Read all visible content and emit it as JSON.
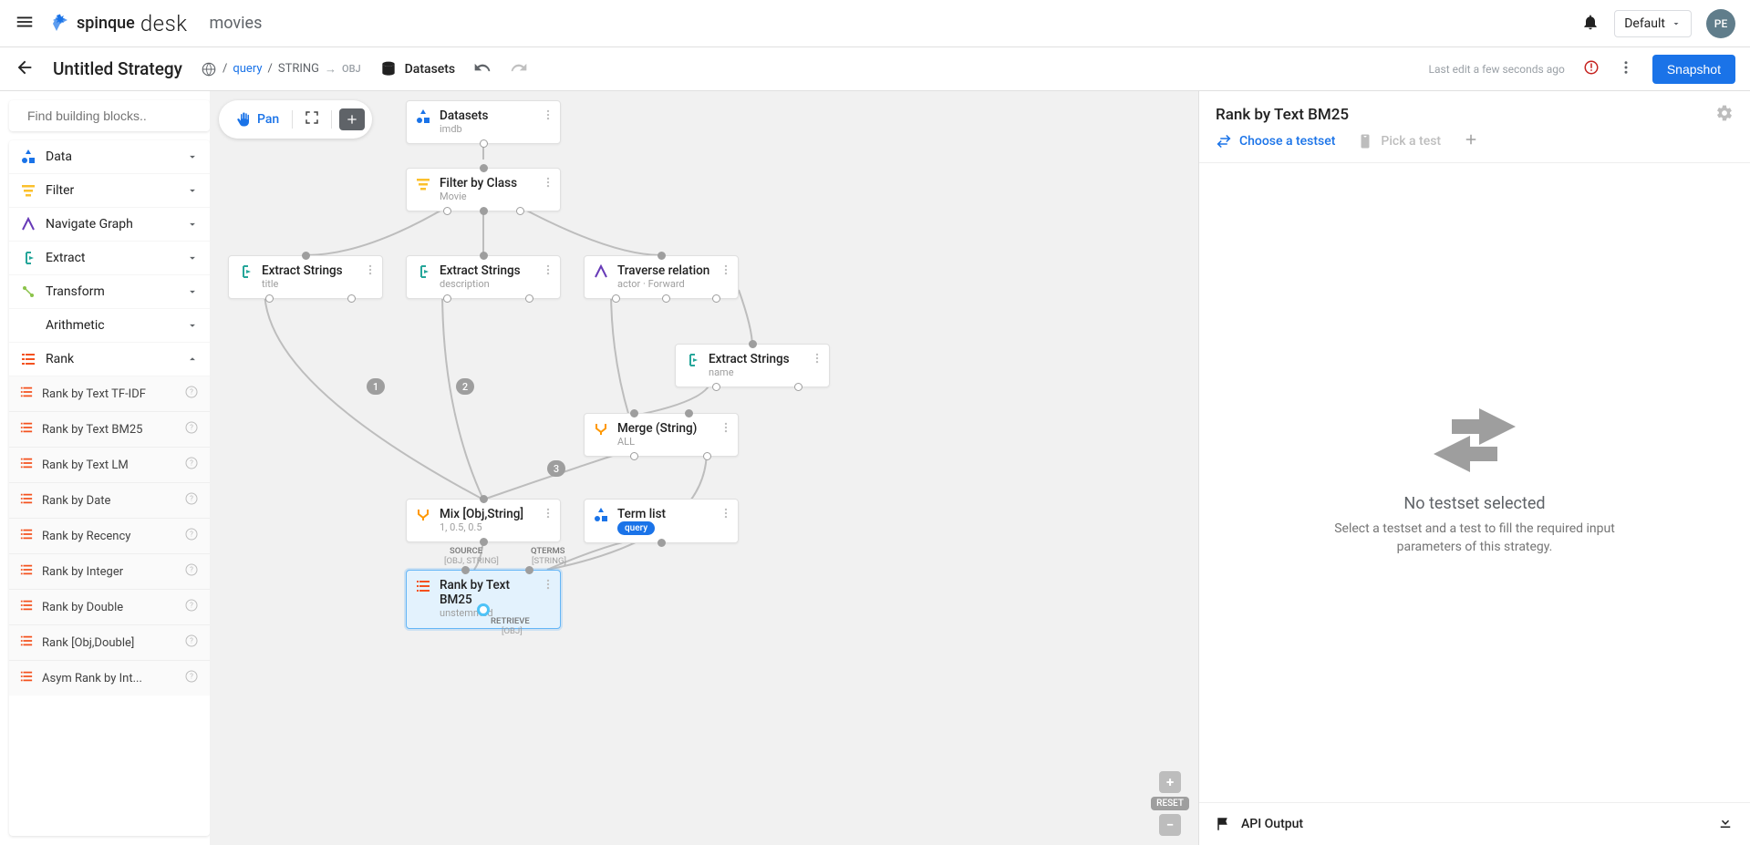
{
  "header": {
    "brand_spinque": "spinque",
    "brand_desk": "desk",
    "app_title": "movies",
    "workspace": "Default",
    "avatar_initials": "PE"
  },
  "strategy": {
    "title": "Untitled Strategy",
    "breadcrumb": {
      "root": "/",
      "query": "query",
      "post_query": "/",
      "string": "STRING",
      "arrow": "→",
      "obj": "OBJ"
    },
    "datasets_label": "Datasets",
    "last_edit": "Last edit a few seconds ago",
    "snapshot": "Snapshot"
  },
  "sidebar": {
    "search_placeholder": "Find building blocks..",
    "categories": [
      {
        "label": "Data",
        "icon": "data",
        "color": "#1a73e8"
      },
      {
        "label": "Filter",
        "icon": "filter",
        "color": "#fbc02d"
      },
      {
        "label": "Navigate Graph",
        "icon": "traverse",
        "color": "#673ab7"
      },
      {
        "label": "Extract",
        "icon": "extract",
        "color": "#26a69a"
      },
      {
        "label": "Transform",
        "icon": "transform",
        "color": "#8bc34a"
      },
      {
        "label": "Arithmetic",
        "icon": "",
        "color": ""
      },
      {
        "label": "Rank",
        "icon": "rank",
        "color": "#f4511e"
      }
    ],
    "rank_items": [
      "Rank by Text TF-IDF",
      "Rank by Text BM25",
      "Rank by Text LM",
      "Rank by Date",
      "Rank by Recency",
      "Rank by Integer",
      "Rank by Double",
      "Rank [Obj,Double]",
      "Asym Rank by Int..."
    ]
  },
  "canvas": {
    "pan": "Pan",
    "reset": "RESET",
    "nodes": {
      "datasets": {
        "title": "Datasets",
        "sub": "imdb"
      },
      "filter": {
        "title": "Filter by Class",
        "sub": "Movie"
      },
      "extract_title": {
        "title": "Extract Strings",
        "sub": "title"
      },
      "extract_desc": {
        "title": "Extract Strings",
        "sub": "description"
      },
      "traverse": {
        "title": "Traverse relation",
        "sub": "actor · Forward"
      },
      "extract_name": {
        "title": "Extract Strings",
        "sub": "name"
      },
      "merge": {
        "title": "Merge (String)",
        "sub": "ALL"
      },
      "mix": {
        "title": "Mix [Obj,String]",
        "sub": "1, 0.5, 0.5"
      },
      "term": {
        "title": "Term list",
        "badge": "query"
      },
      "rank": {
        "title": "Rank by Text BM25",
        "sub": "unstemmed"
      }
    },
    "port_labels": {
      "source": "SOURCE",
      "source_type": "[OBJ, STRING]",
      "qterms": "QTERMS",
      "qterms_type": "[STRING]",
      "retrieve": "RETRIEVE",
      "retrieve_type": "[OBJ]"
    },
    "edge_nums": [
      "1",
      "2",
      "3"
    ]
  },
  "right": {
    "title": "Rank by Text BM25",
    "tab_choose": "Choose a testset",
    "tab_pick": "Pick a test",
    "empty_title": "No testset selected",
    "empty_sub": "Select a testset and a test to fill the required input parameters of this strategy.",
    "footer": "API Output"
  }
}
